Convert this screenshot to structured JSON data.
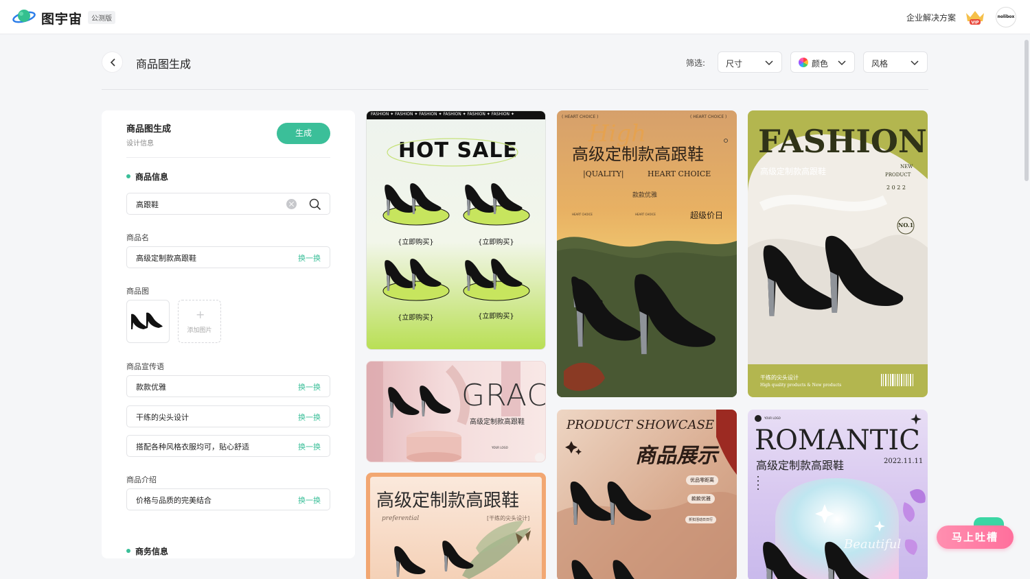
{
  "header": {
    "brand": "图宇宙",
    "beta_badge": "公测版",
    "enterprise_link": "企业解决方案",
    "vip_badge": "VIP",
    "avatar_text": "nolibox"
  },
  "title_row": {
    "page_title": "商品图生成",
    "filter_label": "筛选:",
    "filters": {
      "size": "尺寸",
      "color": "颜色",
      "style": "风格"
    }
  },
  "panel": {
    "title": "商品图生成",
    "subtitle": "设计信息",
    "generate_button": "生成",
    "product_info_section": "商品信息",
    "search_value": "高跟鞋",
    "product_name_label": "商品名",
    "product_name_value": "高级定制款高跟鞋",
    "swap_label": "换一换",
    "product_image_label": "商品图",
    "add_image_label": "添加图片",
    "slogan_label": "商品宣传语",
    "slogans": [
      "款款优雅",
      "干练的尖头设计",
      "搭配各种风格衣服均可，贴心舒适"
    ],
    "intro_label": "商品介绍",
    "intro_value": "价格与品质的完美结合",
    "business_section": "商务信息"
  },
  "cards": {
    "hot_sale": {
      "ribbon": "FASHION ✦ FASHION ✦ FASHION ✦ FASHION ✦ FASHION ✦ FASHION ✦",
      "headline": "HOT SALE",
      "buy_now": "{立即购买}"
    },
    "high": {
      "top_left": "( HEART CHOICE )",
      "top_right": "( HEART CHOICE )",
      "script": "High",
      "headline": "高级定制款高跟鞋",
      "quality": "|QUALITY|",
      "heart_choice": "HEART CHOICE",
      "elegant": "款款优雅",
      "small_a": "HEART CHOICE",
      "small_b": "HEART CHOICE",
      "super_price": "超级价日"
    },
    "fashion": {
      "headline": "FASHION",
      "sub": "高级定制款高跟鞋",
      "new_product": "NEW",
      "product": "PRODUCT",
      "year": "2 0 2 2",
      "badge": "NO.1",
      "footer_cn": "干练的尖头设计",
      "footer_en": "High quality products & New products"
    },
    "grace": {
      "headline": "GRACE",
      "sub": "高级定制款高跟鞋",
      "logo": "YOUR LOGO"
    },
    "showcase": {
      "en": "PRODUCT  SHOWCASE",
      "cn": "商品展示",
      "tag1": "优品零距离",
      "tag2": "款款优雅",
      "tag3": "折扣活动日日行"
    },
    "romantic": {
      "logo": "YOUR LOGO",
      "headline": "ROMANTIC",
      "sub": "高级定制款高跟鞋",
      "date": "2022.11.11",
      "script": "Beautiful"
    },
    "peach": {
      "headline": "高级定制款高跟鞋",
      "script": "preferential",
      "tag": "[干练的尖头设计]"
    }
  },
  "feedback_button": "马上吐槽"
}
